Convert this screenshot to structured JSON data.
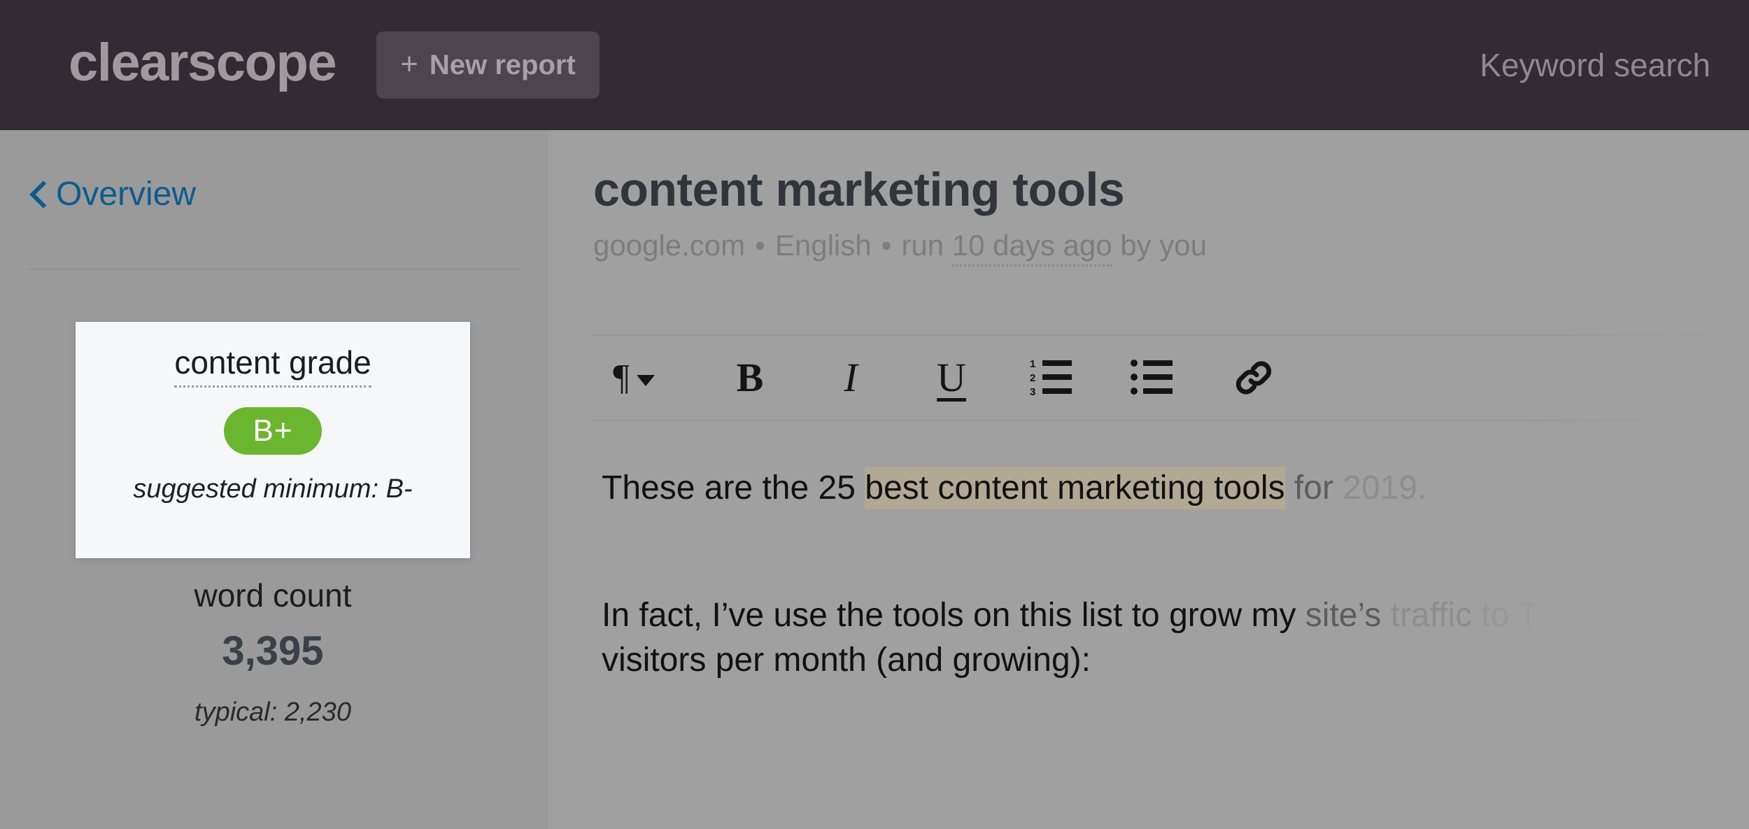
{
  "app": {
    "brand": "clearscope",
    "background_color": "#9b9b9b",
    "header_color": "#342a33"
  },
  "topbar": {
    "brand": "clearscope",
    "new_report_plus": "+",
    "new_report_label": "New report",
    "keyword_search_label": "Keyword search"
  },
  "sidebar": {
    "overview_label": "Overview",
    "content_grade": {
      "title": "content grade",
      "grade": "B+",
      "grade_color": "#6cb52e",
      "suggested": "suggested minimum: B-"
    },
    "word_count": {
      "title": "word count",
      "value": "3,395",
      "typical": "typical: 2,230"
    }
  },
  "main": {
    "doc_title": "content marketing tools",
    "meta": {
      "source": "google.com",
      "separator": "•",
      "language": "English",
      "run_prefix": "run",
      "run_age": "10 days ago",
      "run_suffix": "by you"
    },
    "toolbar": [
      {
        "name": "paragraph-style",
        "glyph": "¶",
        "caret": true
      },
      {
        "name": "bold",
        "glyph": "B"
      },
      {
        "name": "italic",
        "glyph": "I"
      },
      {
        "name": "underline",
        "glyph": "U"
      },
      {
        "name": "numbered-list",
        "glyph": ""
      },
      {
        "name": "bulleted-list",
        "glyph": ""
      },
      {
        "name": "link",
        "glyph": ""
      }
    ],
    "paragraph_1": {
      "before": "These are the 25 ",
      "highlight": "best content marketing tools",
      "after_a": " for ",
      "after_b": "2019."
    },
    "paragraph_2": {
      "line_1_a": "In fact, I’ve use the tools on this list to grow my ",
      "line_1_b": "site’s ",
      "line_1_c": "traffic ",
      "line_1_d": "to ",
      "line_1_e": "T",
      "line_2": "visitors per month (and growing):"
    }
  }
}
